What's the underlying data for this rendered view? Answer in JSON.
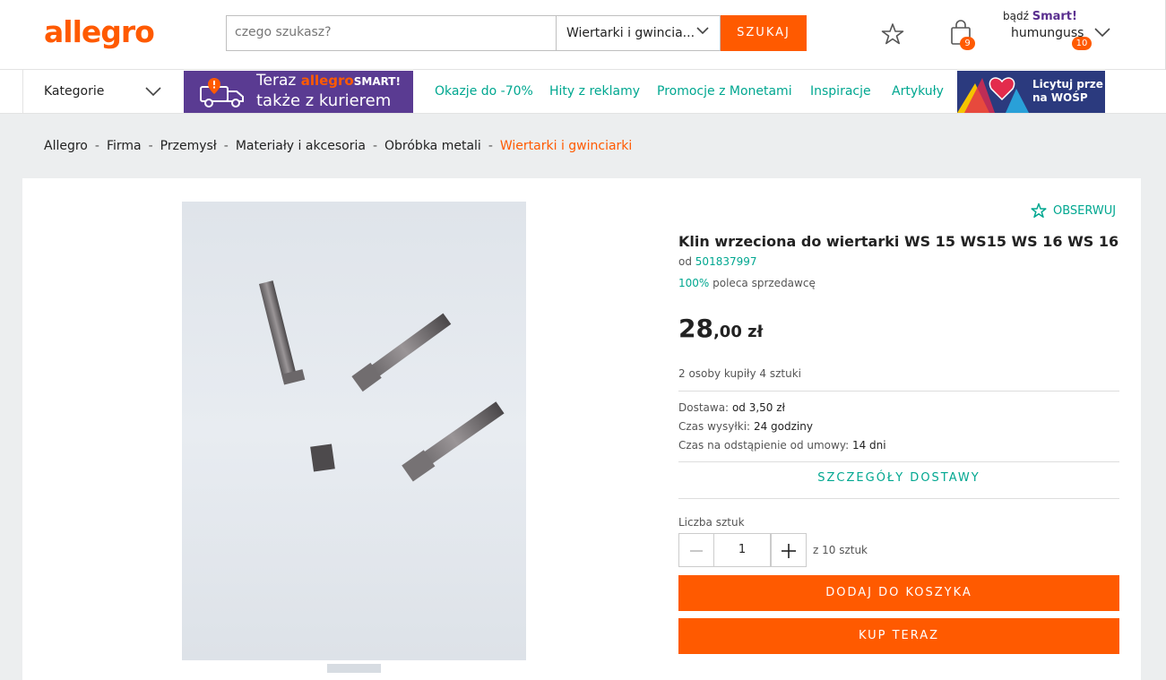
{
  "header": {
    "logo": "allegro",
    "search_placeholder": "czego szukasz?",
    "category_value": "Wiertarki i gwincia...",
    "search_button": "SZUKAJ",
    "cart_count": "9",
    "smart_prefix": "bądź",
    "smart_label": "Smart!",
    "username": "humunguss",
    "user_count": "10"
  },
  "nav": {
    "categories": "Kategorie",
    "smart_banner": {
      "line1_prefix": "Teraz",
      "line1_brand": "allegro",
      "line1_smart": "SMART!",
      "line2": "także z kurierem"
    },
    "links": [
      "Okazje do -70%",
      "Hity z reklamy",
      "Promocje z Monetami",
      "Inspiracje",
      "Artykuły"
    ],
    "wosp_banner": {
      "line1": "Licytuj prze",
      "line2": "na WOŚP"
    }
  },
  "breadcrumb": {
    "items": [
      "Allegro",
      "Firma",
      "Przemysł",
      "Materiały i akcesoria",
      "Obróbka metali",
      "Wiertarki i gwinciarki"
    ],
    "separator": "-"
  },
  "product": {
    "observe": "OBSERWUJ",
    "title": "Klin wrzeciona do wiertarki WS 15 WS15 WS 16 WS 16",
    "seller_prefix": "od",
    "seller_id": "501837997",
    "recommend_pct": "100%",
    "recommend_text": "poleca sprzedawcę",
    "price_main": "28",
    "price_rest": ",00 zł",
    "bought": "2 osoby kupiły 4 sztuki",
    "delivery_label": "Dostawa:",
    "delivery_value": "od 3,50 zł",
    "shipping_label": "Czas wysyłki:",
    "shipping_value": "24 godziny",
    "withdrawal_label": "Czas na odstąpienie od umowy:",
    "withdrawal_value": "14 dni",
    "delivery_details": "SZCZEGÓŁY DOSTAWY",
    "qty_label": "Liczba sztuk",
    "qty_value": "1",
    "qty_of": "z 10 sztuk",
    "add_to_cart": "DODAJ DO KOSZYKA",
    "buy_now": "KUP TERAZ"
  },
  "colors": {
    "accent": "#ff5a00",
    "link": "#00a790",
    "smart_purple": "#5a3b92"
  }
}
